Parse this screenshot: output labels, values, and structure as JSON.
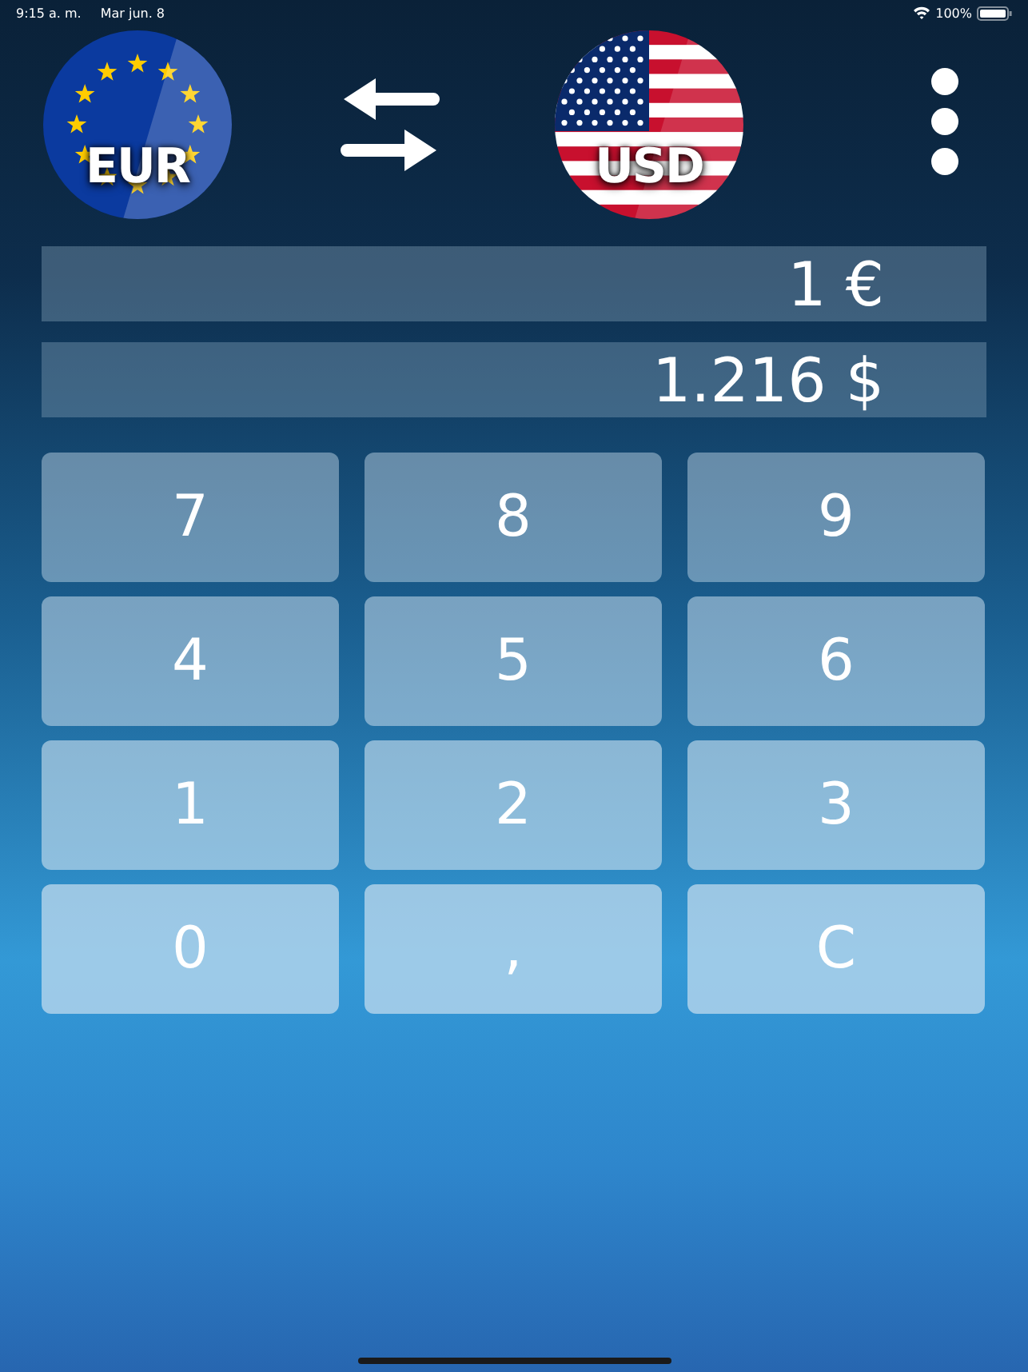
{
  "status_bar": {
    "time": "9:15 a. m.",
    "date": "Mar jun. 8",
    "battery": "100%"
  },
  "from_currency": {
    "code": "EUR",
    "kind": "eu"
  },
  "to_currency": {
    "code": "USD",
    "kind": "us"
  },
  "amounts": [
    {
      "value": "1 €"
    },
    {
      "value": "1.216 $"
    }
  ],
  "keypad_rows": [
    [
      "7",
      "8",
      "9"
    ],
    [
      "4",
      "5",
      "6"
    ],
    [
      "1",
      "2",
      "3"
    ],
    [
      "0",
      ",",
      "C"
    ]
  ]
}
